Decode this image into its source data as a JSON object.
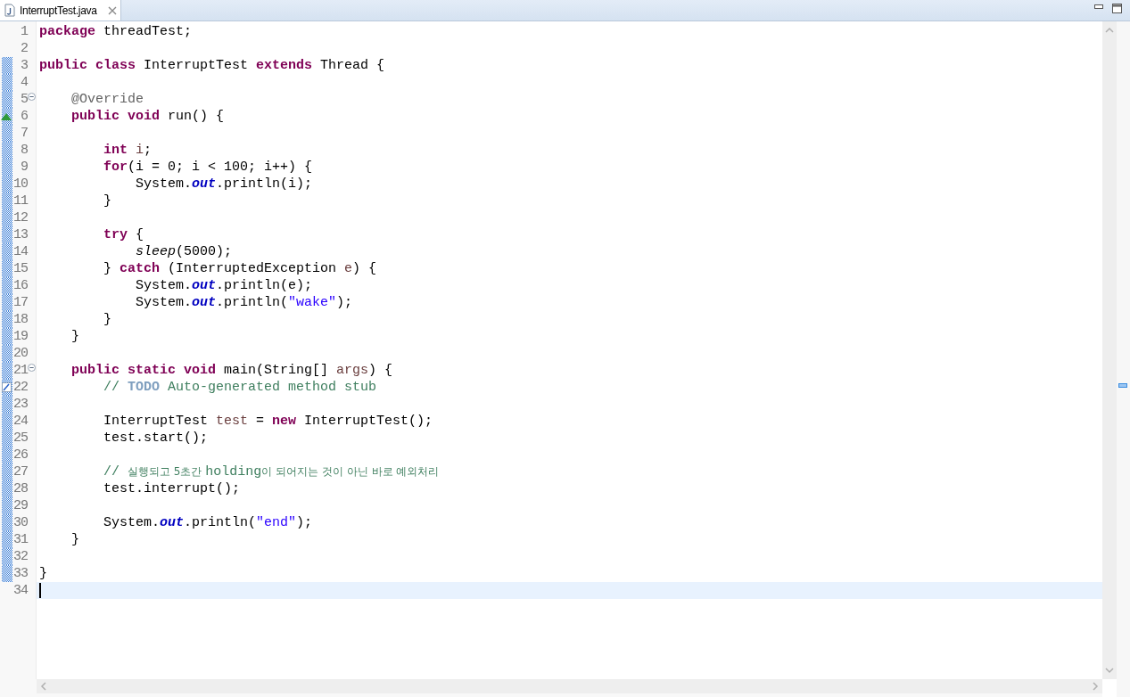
{
  "tab": {
    "title": "InterruptTest.java",
    "selected": true
  },
  "lines": [
    {
      "number": "1",
      "changed": false,
      "kind": "plain",
      "tokens": [
        {
          "kind": "keyword",
          "text": "package "
        },
        {
          "kind": "plain",
          "text": "threadTest;"
        }
      ]
    },
    {
      "number": "2",
      "changed": false,
      "kind": "plain"
    },
    {
      "number": "3",
      "changed": true,
      "kind": "plain",
      "tokens": [
        {
          "kind": "keyword",
          "text": "public class "
        },
        {
          "kind": "plain",
          "text": "InterruptTest "
        },
        {
          "kind": "keyword",
          "text": "extends "
        },
        {
          "kind": "plain",
          "text": "Thread {"
        }
      ]
    },
    {
      "number": "4",
      "changed": true,
      "kind": "plain"
    },
    {
      "number": "5",
      "changed": true,
      "kind": "fold",
      "tokens": [
        {
          "kind": "annotation",
          "text": "    @Override"
        }
      ]
    },
    {
      "number": "6",
      "changed": true,
      "kind": "override",
      "tokens": [
        {
          "kind": "keyword",
          "text": "    public void "
        },
        {
          "kind": "plain",
          "text": "run() {"
        }
      ]
    },
    {
      "number": "7",
      "changed": true,
      "kind": "plain"
    },
    {
      "number": "8",
      "changed": true,
      "kind": "plain",
      "tokens": [
        {
          "kind": "keyword",
          "text": "        int "
        },
        {
          "kind": "variable",
          "text": "i"
        },
        {
          "kind": "plain",
          "text": ";"
        }
      ]
    },
    {
      "number": "9",
      "changed": true,
      "kind": "plain",
      "tokens": [
        {
          "kind": "keyword",
          "text": "        for"
        },
        {
          "kind": "plain",
          "text": "(i = 0; i < 100; i++) {"
        }
      ]
    },
    {
      "number": "10",
      "changed": true,
      "kind": "plain",
      "tokens": [
        {
          "kind": "plain",
          "text": "            System."
        },
        {
          "kind": "field",
          "text": "out"
        },
        {
          "kind": "plain",
          "text": ".println(i);"
        }
      ]
    },
    {
      "number": "11",
      "changed": true,
      "kind": "plain",
      "tokens": [
        {
          "kind": "plain",
          "text": "        }"
        }
      ]
    },
    {
      "number": "12",
      "changed": true,
      "kind": "plain"
    },
    {
      "number": "13",
      "changed": true,
      "kind": "plain",
      "tokens": [
        {
          "kind": "keyword",
          "text": "        try "
        },
        {
          "kind": "plain",
          "text": "{"
        }
      ]
    },
    {
      "number": "14",
      "changed": true,
      "kind": "plain",
      "tokens": [
        {
          "kind": "static",
          "text": "            sleep"
        },
        {
          "kind": "plain",
          "text": "(5000);"
        }
      ]
    },
    {
      "number": "15",
      "changed": true,
      "kind": "plain",
      "tokens": [
        {
          "kind": "plain",
          "text": "        } "
        },
        {
          "kind": "keyword",
          "text": "catch "
        },
        {
          "kind": "plain",
          "text": "(InterruptedException "
        },
        {
          "kind": "variable",
          "text": "e"
        },
        {
          "kind": "plain",
          "text": ") {"
        }
      ]
    },
    {
      "number": "16",
      "changed": true,
      "kind": "plain",
      "tokens": [
        {
          "kind": "plain",
          "text": "            System."
        },
        {
          "kind": "field",
          "text": "out"
        },
        {
          "kind": "plain",
          "text": ".println(e);"
        }
      ]
    },
    {
      "number": "17",
      "changed": true,
      "kind": "plain",
      "tokens": [
        {
          "kind": "plain",
          "text": "            System."
        },
        {
          "kind": "field",
          "text": "out"
        },
        {
          "kind": "plain",
          "text": ".println("
        },
        {
          "kind": "string",
          "text": "\"wake\""
        },
        {
          "kind": "plain",
          "text": ");"
        }
      ]
    },
    {
      "number": "18",
      "changed": true,
      "kind": "plain",
      "tokens": [
        {
          "kind": "plain",
          "text": "        }"
        }
      ]
    },
    {
      "number": "19",
      "changed": true,
      "kind": "plain",
      "tokens": [
        {
          "kind": "plain",
          "text": "    }"
        }
      ]
    },
    {
      "number": "20",
      "changed": true,
      "kind": "plain"
    },
    {
      "number": "21",
      "changed": true,
      "kind": "fold",
      "tokens": [
        {
          "kind": "keyword",
          "text": "    public static void "
        },
        {
          "kind": "plain",
          "text": "main(String[] "
        },
        {
          "kind": "variable",
          "text": "args"
        },
        {
          "kind": "plain",
          "text": ") {"
        }
      ]
    },
    {
      "number": "22",
      "changed": true,
      "kind": "task",
      "tokens": [
        {
          "kind": "comment",
          "text": "        // "
        },
        {
          "kind": "todo",
          "text": "TODO"
        },
        {
          "kind": "comment",
          "text": " Auto-generated method stub"
        }
      ]
    },
    {
      "number": "23",
      "changed": true,
      "kind": "plain"
    },
    {
      "number": "24",
      "changed": true,
      "kind": "plain",
      "tokens": [
        {
          "kind": "plain",
          "text": "        InterruptTest "
        },
        {
          "kind": "variable",
          "text": "test"
        },
        {
          "kind": "plain",
          "text": " = "
        },
        {
          "kind": "keyword",
          "text": "new "
        },
        {
          "kind": "plain",
          "text": "InterruptTest();"
        }
      ]
    },
    {
      "number": "25",
      "changed": true,
      "kind": "plain",
      "tokens": [
        {
          "kind": "plain",
          "text": "        test.start();"
        }
      ]
    },
    {
      "number": "26",
      "changed": true,
      "kind": "plain"
    },
    {
      "number": "27",
      "changed": true,
      "kind": "plain",
      "tokens": [
        {
          "kind": "comment",
          "text": "        // "
        },
        {
          "kind": "korean",
          "text": "실행되고 5초간 "
        },
        {
          "kind": "comment",
          "text": "holding"
        },
        {
          "kind": "korean",
          "text": "이 되어지는 것이 아닌 바로 예외처리"
        }
      ]
    },
    {
      "number": "28",
      "changed": true,
      "kind": "plain",
      "tokens": [
        {
          "kind": "plain",
          "text": "        test.interrupt();"
        }
      ]
    },
    {
      "number": "29",
      "changed": true,
      "kind": "plain"
    },
    {
      "number": "30",
      "changed": true,
      "kind": "plain",
      "tokens": [
        {
          "kind": "plain",
          "text": "        System."
        },
        {
          "kind": "field",
          "text": "out"
        },
        {
          "kind": "plain",
          "text": ".println("
        },
        {
          "kind": "string",
          "text": "\"end\""
        },
        {
          "kind": "plain",
          "text": ");"
        }
      ]
    },
    {
      "number": "31",
      "changed": true,
      "kind": "plain",
      "tokens": [
        {
          "kind": "plain",
          "text": "    }"
        }
      ]
    },
    {
      "number": "32",
      "changed": true,
      "kind": "plain"
    },
    {
      "number": "33",
      "changed": true,
      "kind": "plain",
      "tokens": [
        {
          "kind": "plain",
          "text": "}"
        }
      ]
    },
    {
      "number": "34",
      "changed": false,
      "current": true,
      "kind": "plain"
    }
  ]
}
